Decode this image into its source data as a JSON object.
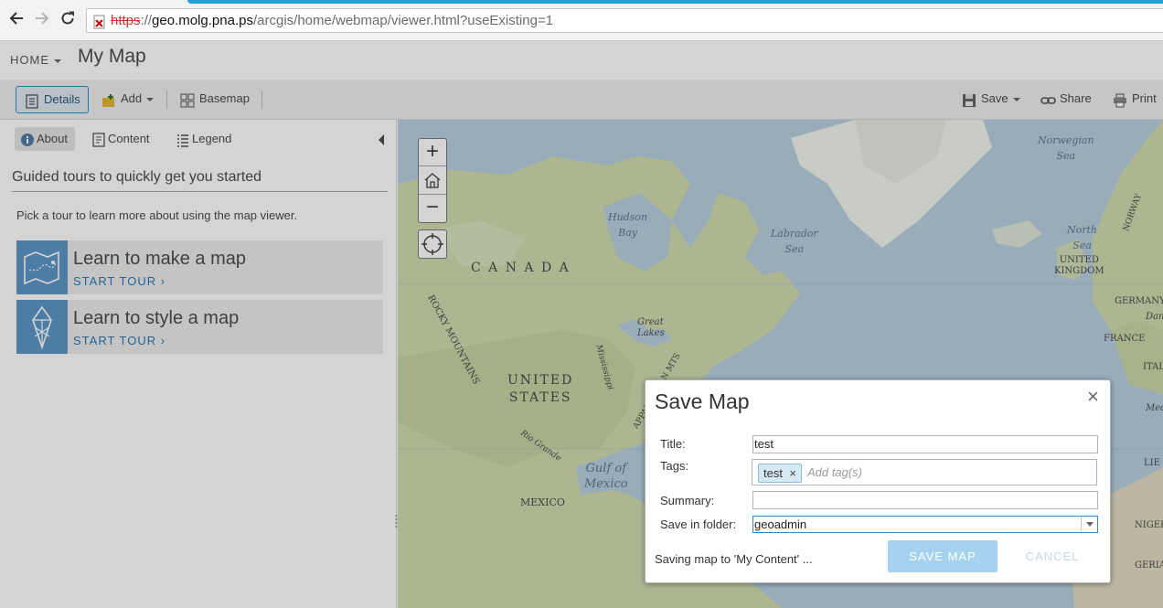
{
  "browser": {
    "url_scheme": "https",
    "url_sep": "://",
    "url_host": "geo.molg.pna.ps",
    "url_path": "/arcgis/home/webmap/viewer.html?useExisting=1"
  },
  "header": {
    "home_label": "HOME",
    "map_title": "My Map"
  },
  "toolbar": {
    "details_label": "Details",
    "add_label": "Add",
    "basemap_label": "Basemap",
    "save_label": "Save",
    "share_label": "Share",
    "print_label": "Print"
  },
  "side_panel": {
    "tabs": [
      {
        "label": "About"
      },
      {
        "label": "Content"
      },
      {
        "label": "Legend"
      }
    ],
    "heading": "Guided tours to quickly get you started",
    "intro": "Pick a tour to learn more about using the map viewer.",
    "tours": [
      {
        "title": "Learn to make a map",
        "link": "START TOUR ›"
      },
      {
        "title": "Learn to style a map",
        "link": "START TOUR ›"
      }
    ]
  },
  "map": {
    "labels": {
      "canada": "C A N A D A",
      "united_states_1": "UNITED",
      "united_states_2": "STATES",
      "mexico": "MEXICO",
      "uk_1": "UNITED",
      "uk_2": "KINGDOM",
      "france": "FRANCE",
      "germany": "GERMANY",
      "italy": "ITALY",
      "rocky_mountains": "ROCKY MOUNTAINS",
      "great_lakes_1": "Great",
      "great_lakes_2": "Lakes",
      "mississippi": "Mississippi",
      "rio_grande": "Rio Grande",
      "appalachian": "APPALACHIAN MTS",
      "norway": "NORWAY",
      "edge_lie": "LIE",
      "edge_niger": "NIGER",
      "edge_geria": "GERIA",
      "edge_medi": "Medi",
      "edge_danu": "Danu"
    },
    "oceans": {
      "norwegian_1": "Norwegian",
      "norwegian_2": "Sea",
      "hudson_1": "Hudson",
      "hudson_2": "Bay",
      "labrador_1": "Labrador",
      "labrador_2": "Sea",
      "north_1": "North",
      "north_2": "Sea",
      "gulf_1": "Gulf of",
      "gulf_2": "Mexico"
    },
    "zoom_in": "+",
    "zoom_out": "−"
  },
  "dialog": {
    "title": "Save Map",
    "close": "×",
    "title_label": "Title:",
    "title_value": "test",
    "tags_label": "Tags:",
    "tag_chip": "test",
    "tag_remove": "×",
    "tags_placeholder": "Add tag(s)",
    "summary_label": "Summary:",
    "summary_value": "",
    "folder_label": "Save in folder:",
    "folder_value": "geoadmin",
    "status": "Saving map to 'My Content' ...",
    "save_button": "SAVE MAP",
    "cancel_button": "CANCEL"
  },
  "colors": {
    "accent": "#2c90c5",
    "tour_thumb": "#5d97c7",
    "save_button_disabled": "#a5d3ef"
  }
}
